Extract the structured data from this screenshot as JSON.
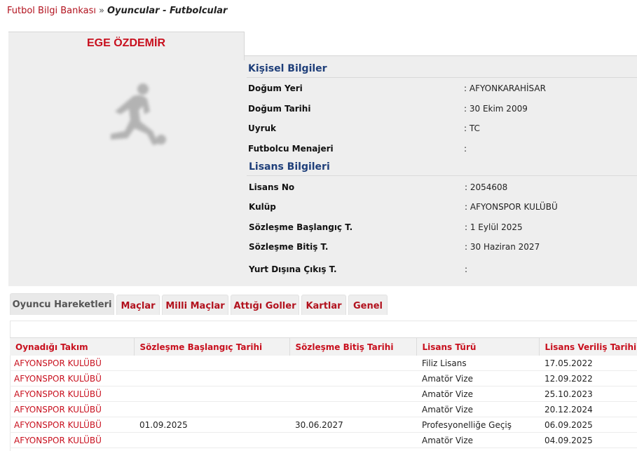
{
  "breadcrumb": {
    "root": "Futbol Bilgi Bankası",
    "separator": "»",
    "current": "Oyuncular - Futbolcular"
  },
  "player": {
    "name": "EGE ÖZDEMİR",
    "photo_icon": "football-player-silhouette-icon"
  },
  "personal": {
    "title": "Kişisel Bilgiler",
    "rows": [
      {
        "label": "Doğum Yeri",
        "value": ":  AFYONKARAHİSAR"
      },
      {
        "label": "Doğum Tarihi",
        "value": ":  30 Ekim 2009"
      },
      {
        "label": "Uyruk",
        "value": ":  TC"
      },
      {
        "label": "Futbolcu Menajeri",
        "value": ":"
      }
    ]
  },
  "license": {
    "title": "Lisans Bilgileri",
    "rows": [
      {
        "label": "Lisans No",
        "value": ": 2054608"
      },
      {
        "label": "Kulüp",
        "value": ": AFYONSPOR KULÜBÜ"
      },
      {
        "label": "Sözleşme Başlangıç T.",
        "value": ": 1 Eylül 2025"
      },
      {
        "label": "Sözleşme Bitiş T.",
        "value": ": 30 Haziran 2027"
      },
      {
        "label": "Yurt Dışına Çıkış T.",
        "value": ":"
      }
    ]
  },
  "tabs": [
    {
      "label": "Oyuncu Hareketleri",
      "active": true
    },
    {
      "label": "Maçlar",
      "active": false
    },
    {
      "label": "Milli Maçlar",
      "active": false
    },
    {
      "label": "Attığı Goller",
      "active": false
    },
    {
      "label": "Kartlar",
      "active": false
    },
    {
      "label": "Genel",
      "active": false
    }
  ],
  "table": {
    "columns": [
      "Oynadığı Takım",
      "Sözleşme Başlangıç Tarihi",
      "Sözleşme Bitiş Tarihi",
      "Lisans Türü",
      "Lisans Veriliş Tarihi"
    ],
    "rows": [
      [
        "AFYONSPOR KULÜBÜ",
        "",
        "",
        "Filiz Lisans",
        "17.05.2022"
      ],
      [
        "AFYONSPOR KULÜBÜ",
        "",
        "",
        "Amatör Vize",
        "12.09.2022"
      ],
      [
        "AFYONSPOR KULÜBÜ",
        "",
        "",
        "Amatör Vize",
        "25.10.2023"
      ],
      [
        "AFYONSPOR KULÜBÜ",
        "",
        "",
        "Amatör Vize",
        "20.12.2024"
      ],
      [
        "AFYONSPOR KULÜBÜ",
        "01.09.2025",
        "30.06.2027",
        "Profesyonelliğe Geçiş",
        "06.09.2025"
      ],
      [
        "AFYONSPOR KULÜBÜ",
        "",
        "",
        "Amatör Vize",
        "04.09.2025"
      ]
    ]
  },
  "colors": {
    "accent_red": "#c8101e",
    "section_blue": "#1f3f7a",
    "panel_gray": "#eeeeee"
  }
}
